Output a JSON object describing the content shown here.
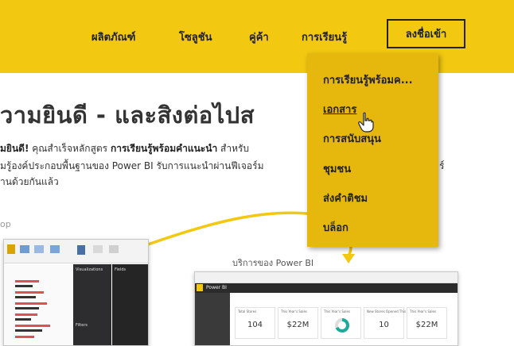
{
  "nav": {
    "products": "ผลิตภัณฑ์",
    "solutions": "โซลูชัน",
    "partners": "คู่ค้า",
    "learning": "การเรียนรู้",
    "signup": "ลงชื่อเข้า"
  },
  "dropdown": {
    "items": [
      "การเรียนรู้พร้อมค...",
      "เอกสาร",
      "การสนับสนุน",
      "ชุมชน",
      "ส่งคำติชม",
      "บล็อก"
    ],
    "active_index": 1
  },
  "hero": {
    "title": "วามยินดี - และสิงต่อไปส"
  },
  "intro": {
    "line1_bold_start": "มยินดี!",
    "line1_text": " คุณสำเร็จหลักสูตร ",
    "line1_bold_mid": "การเรียนรู้พร้อมคำแนะนำ",
    "line1_text_end": " สำหรับ",
    "line2": "มรู้องค์ประกอบพื้นฐานของ Power BI รับการแนะนำผ่านฟีเจอร์ม",
    "line2_tail": "ร์",
    "line3": "านด้วยกันแล้ว"
  },
  "section_label": "op",
  "service_label": "บริการของ Power BI",
  "desktop_mock": {
    "ribbon_label": "Visualizations",
    "fields_label": "Fields",
    "filters_label": "Filters"
  },
  "service_mock": {
    "app_name": "Power BI",
    "tiles": [
      {
        "title": "Total Stores",
        "value": "104"
      },
      {
        "title": "This Year's Sales",
        "value": "$22M"
      },
      {
        "title": "This Year's Sales",
        "value": ""
      },
      {
        "title": "New Stores Opened This Year",
        "value": "10"
      },
      {
        "title": "This Year's Sales",
        "value": "$22M"
      }
    ]
  },
  "colors": {
    "brand_yellow": "#f2c811",
    "dropdown_yellow": "#e6b80d",
    "accent_teal": "#1aab9b"
  },
  "icons": [
    "pointer-hand-icon",
    "connector-arrow-icon"
  ]
}
